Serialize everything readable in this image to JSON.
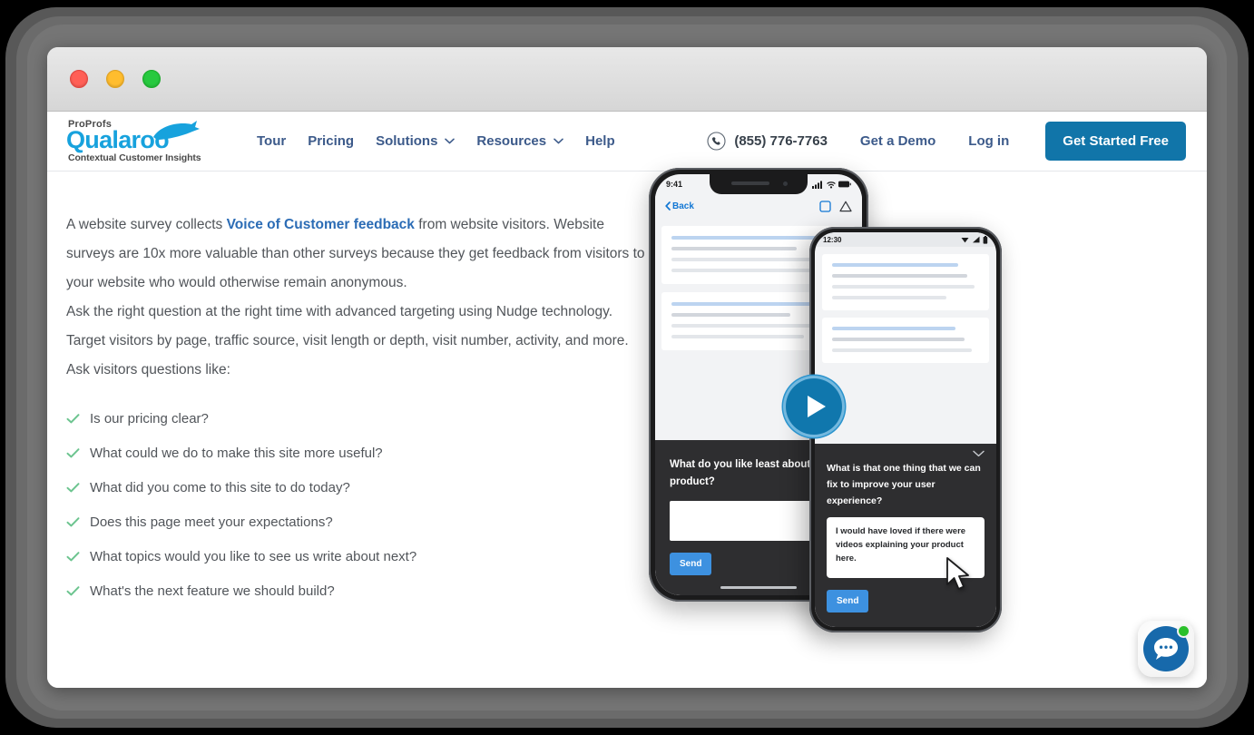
{
  "window": {
    "traffic_lights": [
      "close",
      "minimize",
      "maximize"
    ]
  },
  "header": {
    "logo": {
      "eyebrow": "ProProfs",
      "brand": "Qualaroo",
      "tagline": "Contextual Customer Insights",
      "mark": "kangaroo-icon",
      "brand_color": "#17a2dd"
    },
    "nav": [
      {
        "label": "Tour",
        "has_dropdown": false
      },
      {
        "label": "Pricing",
        "has_dropdown": false
      },
      {
        "label": "Solutions",
        "has_dropdown": true
      },
      {
        "label": "Resources",
        "has_dropdown": true
      },
      {
        "label": "Help",
        "has_dropdown": false
      }
    ],
    "phone": {
      "icon": "phone-icon",
      "number": "(855) 776-7763"
    },
    "links": [
      {
        "label": "Get a Demo"
      },
      {
        "label": "Log in"
      }
    ],
    "cta": {
      "label": "Get Started Free",
      "color": "#1175a9"
    }
  },
  "main": {
    "intro": {
      "p1_before": "A website survey collects ",
      "p1_link": "Voice of Customer feedback",
      "p1_after": " from website visitors. Website surveys are 10x more valuable than other surveys because they get feedback from visitors to your website who would otherwise remain anonymous.",
      "p2": "Ask the right question at the right time with advanced targeting using Nudge technology. Target visitors by page, traffic source, visit length or depth, visit number, activity, and more. Ask visitors questions like:"
    },
    "checklist": {
      "tick_icon": "check-icon",
      "tick_color": "#6cc48f",
      "items": [
        "Is our pricing clear?",
        "What could we do to make this site more useful?",
        "What did you come to this site to do today?",
        "Does this page meet your expectations?",
        "What topics would you like to see us write about next?",
        "What's the next feature we should build?"
      ]
    },
    "media": {
      "play_button": {
        "icon": "play-icon",
        "color": "#1077ad"
      },
      "phone_back": {
        "device": "iphone",
        "status_time": "9:41",
        "nav_back_label": "Back",
        "nav_icons": [
          "square-icon",
          "triangle-icon"
        ],
        "survey": {
          "question": "What do you like least about this product?",
          "answer_value": "",
          "send_label": "Send",
          "send_color": "#3d91e0"
        }
      },
      "phone_front": {
        "device": "android",
        "status_time": "12:30",
        "collapse_icon": "chevron-down-icon",
        "survey": {
          "question": "What is that one thing that we can fix to improve your user experience?",
          "answer_value": "I would have loved if there were videos explaining your product here.",
          "send_label": "Send",
          "send_color": "#3d91e0"
        },
        "cursor": "mouse-pointer-icon"
      }
    }
  },
  "chat_widget": {
    "icon": "chat-bubble-icon",
    "status": "online",
    "status_color": "#2bc02b",
    "bubble_color": "#1769ab"
  }
}
